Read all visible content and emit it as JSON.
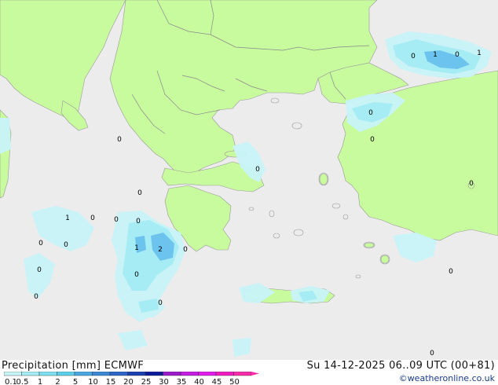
{
  "title": {
    "product": "Precipitation [mm]",
    "model": "ECMWF"
  },
  "valid_time": "Su 14-12-2025 06..09 UTC (00+81)",
  "credit": "©weatheronline.co.uk",
  "legend": {
    "labels": [
      "0.1",
      "0.5",
      "1",
      "2",
      "5",
      "10",
      "15",
      "20",
      "25",
      "30",
      "35",
      "40",
      "45",
      "50"
    ],
    "colors": [
      "#c8f4f8",
      "#a6ecf4",
      "#7ee0ee",
      "#5cd0ea",
      "#4aa8e0",
      "#3c86d6",
      "#2c64c8",
      "#1c40b0",
      "#0c1c98",
      "#9c1ccc",
      "#c41ce0",
      "#e01ce8",
      "#f01cc0",
      "#f82ca8"
    ]
  },
  "colors": {
    "land": "#c8fa9e",
    "sea": "#ececec",
    "precip_light": "#c8f4f8",
    "precip_mid": "#a6ecf4",
    "precip_heavy": "#6cc4ee",
    "border": "#999999"
  },
  "point_values": [
    "1",
    "0",
    "0",
    "1",
    "0",
    "0",
    "0",
    "0",
    "0",
    "0",
    "0",
    "0",
    "0",
    "0",
    "0",
    "0",
    "1",
    "2",
    "0",
    "1",
    "0",
    "0",
    "0",
    "0",
    "0"
  ]
}
